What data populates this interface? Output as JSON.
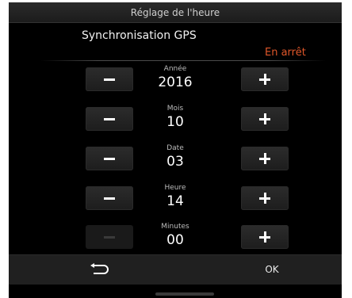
{
  "header": {
    "title": "Réglage de l'heure"
  },
  "gps": {
    "label": "Synchronisation GPS",
    "status": "En arrêt",
    "status_color": "#e0572a"
  },
  "fields": [
    {
      "label": "Année",
      "value": "2016",
      "minus_enabled": true
    },
    {
      "label": "Mois",
      "value": "10",
      "minus_enabled": true
    },
    {
      "label": "Date",
      "value": "03",
      "minus_enabled": true
    },
    {
      "label": "Heure",
      "value": "14",
      "minus_enabled": true
    },
    {
      "label": "Minutes",
      "value": "00",
      "minus_enabled": false
    }
  ],
  "footer": {
    "back_icon": "return-arrow-icon",
    "ok_label": "OK"
  }
}
